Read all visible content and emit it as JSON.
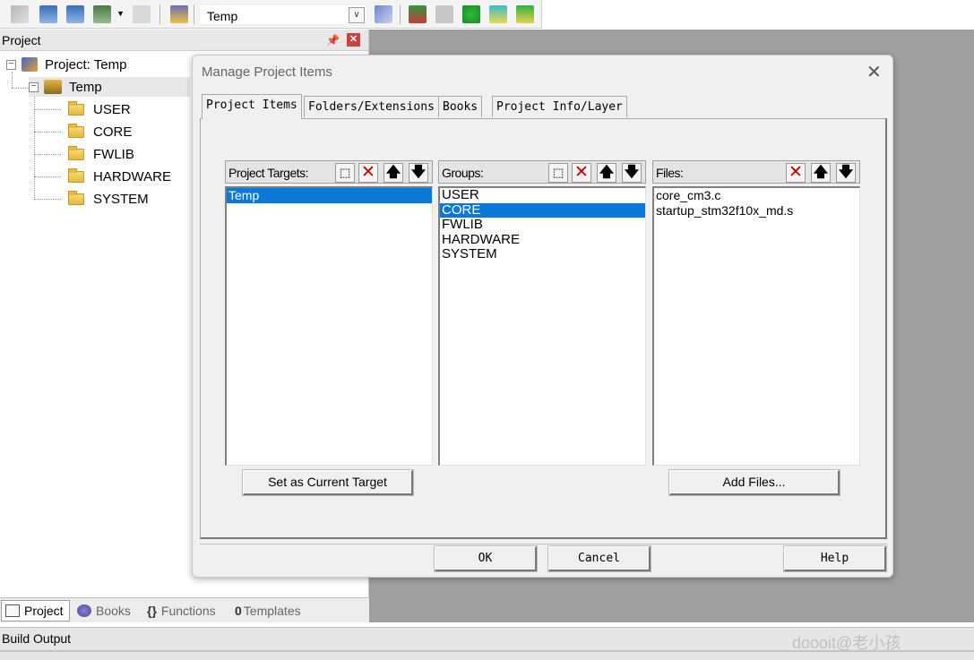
{
  "toolbar": {
    "target_value": "Temp",
    "icons": [
      "translate-icon",
      "build-icon",
      "rebuild-icon",
      "batch-build-icon",
      "stop-build-icon",
      "load-icon",
      "target-options-icon",
      "manage-components-icon",
      "file-extensions-icon",
      "select-packs-icon",
      "pack-installer-icon",
      "manage-run-time-icon"
    ]
  },
  "project_panel": {
    "title": "Project",
    "tree": {
      "root": "Project: Temp",
      "target": "Temp",
      "groups": [
        "USER",
        "CORE",
        "FWLIB",
        "HARDWARE",
        "SYSTEM"
      ]
    },
    "tabs": [
      "Project",
      "Books",
      "Functions",
      "Templates"
    ],
    "tab_prefixes": {
      "functions": "{}",
      "templates": "0"
    }
  },
  "build_output": {
    "title": "Build Output"
  },
  "watermark": "doooit@老小孩",
  "dialog": {
    "title": "Manage Project Items",
    "tabs": [
      "Project Items",
      "Folders/Extensions",
      "Books",
      "Project Info/Layer"
    ],
    "targets": {
      "label": "Project Targets:",
      "items": [
        "Temp"
      ],
      "selected": 0
    },
    "groups": {
      "label": "Groups:",
      "items": [
        "USER",
        "CORE",
        "FWLIB",
        "HARDWARE",
        "SYSTEM"
      ],
      "selected": 1
    },
    "files": {
      "label": "Files:",
      "items": [
        "core_cm3.c",
        "startup_stm32f10x_md.s"
      ]
    },
    "set_current_target": "Set as Current Target",
    "add_files": "Add Files...",
    "ok": "OK",
    "cancel": "Cancel",
    "help": "Help",
    "glyphs": {
      "delete": "✕",
      "up": "🡅",
      "down": "🡇",
      "new": "⬚"
    }
  },
  "colors": {
    "selection": "#0a78d7",
    "workspace": "#a0a0a0"
  }
}
